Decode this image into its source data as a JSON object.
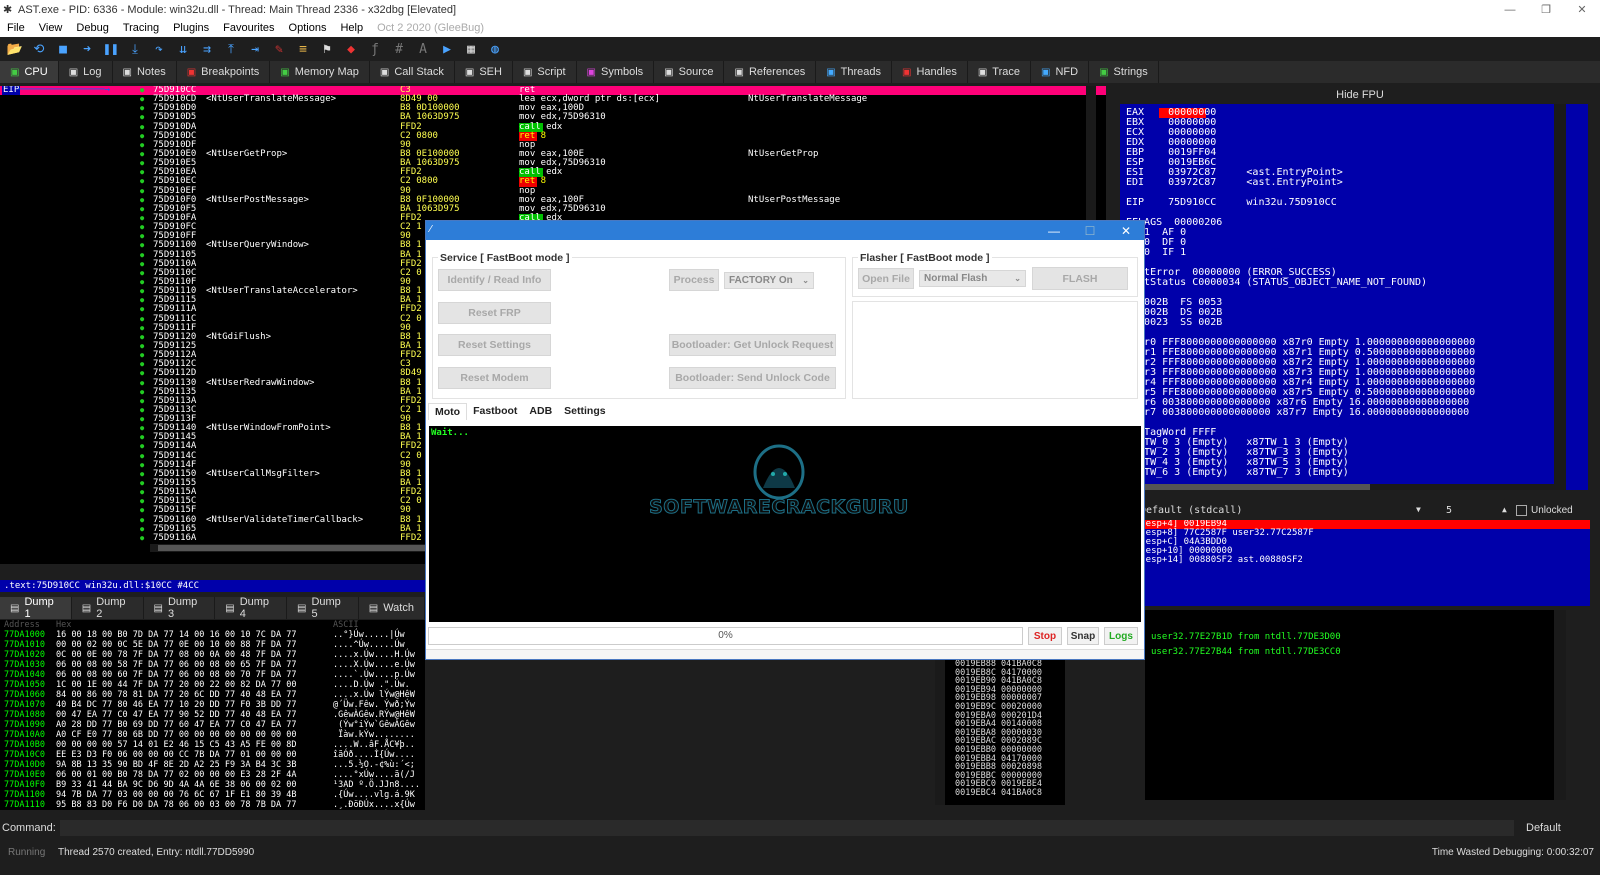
{
  "window": {
    "title": "AST.exe - PID: 6336 - Module: win32u.dll - Thread: Main Thread 2336 - x32dbg [Elevated]",
    "minimize": "—",
    "restore": "❐",
    "close": "✕"
  },
  "menu": [
    "File",
    "View",
    "Debug",
    "Tracing",
    "Plugins",
    "Favourites",
    "Options",
    "Help"
  ],
  "menu_date": "Oct 2 2020 (GleeBug)",
  "toolbar": [
    "open-icon",
    "restart-icon",
    "stop-icon",
    "run-icon",
    "pause-icon",
    "step-into-icon",
    "step-over-icon",
    "trace-into-icon",
    "trace-over-icon",
    "execute-till-return-icon",
    "run-to-user-code-icon",
    "patch-icon",
    "comment-icon",
    "label-icon",
    "bookmark-icon",
    "function-icon",
    "hash-icon",
    "font-icon",
    "script-icon",
    "calculator-icon",
    "globe-icon"
  ],
  "tabs": [
    {
      "label": "CPU",
      "icon": "cpu-icon",
      "color": "#4c4"
    },
    {
      "label": "Log",
      "icon": "log-icon",
      "color": "#ddd"
    },
    {
      "label": "Notes",
      "icon": "notes-icon",
      "color": "#ddd"
    },
    {
      "label": "Breakpoints",
      "icon": "breakpoint-icon",
      "color": "#e33"
    },
    {
      "label": "Memory Map",
      "icon": "memory-icon",
      "color": "#4c4"
    },
    {
      "label": "Call Stack",
      "icon": "callstack-icon",
      "color": "#ddd"
    },
    {
      "label": "SEH",
      "icon": "seh-icon",
      "color": "#ddd"
    },
    {
      "label": "Script",
      "icon": "script-icon",
      "color": "#ddd"
    },
    {
      "label": "Symbols",
      "icon": "symbols-icon",
      "color": "#d4d"
    },
    {
      "label": "Source",
      "icon": "source-icon",
      "color": "#ddd"
    },
    {
      "label": "References",
      "icon": "references-icon",
      "color": "#ddd"
    },
    {
      "label": "Threads",
      "icon": "threads-icon",
      "color": "#4af"
    },
    {
      "label": "Handles",
      "icon": "handles-icon",
      "color": "#e33"
    },
    {
      "label": "Trace",
      "icon": "trace-icon",
      "color": "#ddd"
    },
    {
      "label": "NFD",
      "icon": "nfd-icon",
      "color": "#4af"
    },
    {
      "label": "Strings",
      "icon": "strings-icon",
      "color": "#4c4"
    }
  ],
  "disasm": [
    [
      "EIP",
      "75D910CC",
      "",
      "C3",
      "ret",
      ""
    ],
    [
      "",
      "75D910CD",
      "<NtUserTranslateMessage>",
      "8D49 00",
      "lea ecx,dword ptr ds:[ecx]",
      "NtUserTranslateMessage"
    ],
    [
      "",
      "75D910D0",
      "",
      "B8 0D100000",
      "mov eax,100D",
      ""
    ],
    [
      "",
      "75D910D5",
      "",
      "BA 1063D975",
      "mov edx,75D96310",
      ""
    ],
    [
      "",
      "75D910DA",
      "",
      "FFD2",
      "call edx",
      ""
    ],
    [
      "",
      "75D910DC",
      "",
      "C2 0800",
      "ret 8",
      ""
    ],
    [
      "",
      "75D910DF",
      "",
      "90",
      "nop",
      ""
    ],
    [
      "",
      "75D910E0",
      "<NtUserGetProp>",
      "B8 0E100000",
      "mov eax,100E",
      "NtUserGetProp"
    ],
    [
      "",
      "75D910E5",
      "",
      "BA 1063D975",
      "mov edx,75D96310",
      ""
    ],
    [
      "",
      "75D910EA",
      "",
      "FFD2",
      "call edx",
      ""
    ],
    [
      "",
      "75D910EC",
      "",
      "C2 0800",
      "ret 8",
      ""
    ],
    [
      "",
      "75D910EF",
      "",
      "90",
      "nop",
      ""
    ],
    [
      "",
      "75D910F0",
      "<NtUserPostMessage>",
      "B8 0F100000",
      "mov eax,100F",
      "NtUserPostMessage"
    ],
    [
      "",
      "75D910F5",
      "",
      "BA 1063D975",
      "mov edx,75D96310",
      ""
    ],
    [
      "",
      "75D910FA",
      "",
      "FFD2",
      "call edx",
      ""
    ],
    [
      "",
      "75D910FC",
      "",
      "C2 1",
      "",
      ""
    ],
    [
      "",
      "75D910FF",
      "",
      "90",
      "",
      ""
    ],
    [
      "",
      "75D91100",
      "<NtUserQueryWindow>",
      "B8 1",
      "",
      ""
    ],
    [
      "",
      "75D91105",
      "",
      "BA 1",
      "",
      ""
    ],
    [
      "",
      "75D9110A",
      "",
      "FFD2",
      "",
      ""
    ],
    [
      "",
      "75D9110C",
      "",
      "C2 0",
      "",
      ""
    ],
    [
      "",
      "75D9110F",
      "",
      "90",
      "",
      ""
    ],
    [
      "",
      "75D91110",
      "<NtUserTranslateAccelerator>",
      "B8 1",
      "",
      ""
    ],
    [
      "",
      "75D91115",
      "",
      "BA 1",
      "",
      ""
    ],
    [
      "",
      "75D9111A",
      "",
      "FFD2",
      "",
      ""
    ],
    [
      "",
      "75D9111C",
      "",
      "C2 0",
      "",
      ""
    ],
    [
      "",
      "75D9111F",
      "",
      "90",
      "",
      ""
    ],
    [
      "",
      "75D91120",
      "<NtGdiFlush>",
      "B8 1",
      "",
      ""
    ],
    [
      "",
      "75D91125",
      "",
      "BA 1",
      "",
      ""
    ],
    [
      "",
      "75D9112A",
      "",
      "FFD2",
      "",
      ""
    ],
    [
      "",
      "75D9112C",
      "",
      "C3",
      "",
      ""
    ],
    [
      "",
      "75D9112D",
      "",
      "8D49",
      "",
      ""
    ],
    [
      "",
      "75D91130",
      "<NtUserRedrawWindow>",
      "B8 1",
      "",
      ""
    ],
    [
      "",
      "75D91135",
      "",
      "BA 1",
      "",
      ""
    ],
    [
      "",
      "75D9113A",
      "",
      "FFD2",
      "",
      ""
    ],
    [
      "",
      "75D9113C",
      "",
      "C2 1",
      "",
      ""
    ],
    [
      "",
      "75D9113F",
      "",
      "90",
      "",
      ""
    ],
    [
      "",
      "75D91140",
      "<NtUserWindowFromPoint>",
      "B8 1",
      "",
      ""
    ],
    [
      "",
      "75D91145",
      "",
      "BA 1",
      "",
      ""
    ],
    [
      "",
      "75D9114A",
      "",
      "FFD2",
      "",
      ""
    ],
    [
      "",
      "75D9114C",
      "",
      "C2 0",
      "",
      ""
    ],
    [
      "",
      "75D9114F",
      "",
      "90",
      "",
      ""
    ],
    [
      "",
      "75D91150",
      "<NtUserCallMsgFilter>",
      "B8 1",
      "",
      ""
    ],
    [
      "",
      "75D91155",
      "",
      "BA 1",
      "",
      ""
    ],
    [
      "",
      "75D9115A",
      "",
      "FFD2",
      "",
      ""
    ],
    [
      "",
      "75D9115C",
      "",
      "C2 0",
      "",
      ""
    ],
    [
      "",
      "75D9115F",
      "",
      "90",
      "",
      ""
    ],
    [
      "",
      "75D91160",
      "<NtUserValidateTimerCallback>",
      "B8 1",
      "",
      ""
    ],
    [
      "",
      "75D91165",
      "",
      "BA 1",
      "",
      ""
    ],
    [
      "",
      "75D9116A",
      "",
      "FFD2",
      "",
      ""
    ]
  ],
  "info_line": ".text:75D910CC win32u.dll:$10CC #4CC",
  "regs": {
    "header": "Hide FPU",
    "lines": [
      "EAX    00000000",
      "EBX    00000000",
      "ECX    00000000",
      "EDX    00000000",
      "EBP    0019FF04",
      "ESP    0019EB6C",
      "ESI    03972C87     <ast.EntryPoint>",
      "EDI    03972C87     <ast.EntryPoint>",
      "",
      "EIP    75D910CC     win32u.75D910CC",
      "",
      "EFLAGS  00000206",
      "ZF 1  AF 0",
      "OF 0  DF 0",
      "CF 0  IF 1",
      "",
      "LastError  00000000 (ERROR_SUCCESS)",
      "LastStatus C0000034 (STATUS_OBJECT_NAME_NOT_FOUND)",
      "",
      "GS 002B  FS 0053",
      "ES 002B  DS 002B",
      "CS 0023  SS 002B",
      "",
      "x87r0 FFF8000000000000000 x87r0 Empty 1.000000000000000000",
      "x87r1 FFE8000000000000000 x87r1 Empty 0.500000000000000000",
      "x87r2 FFF8000000000000000 x87r2 Empty 1.000000000000000000",
      "x87r3 FFF8000000000000000 x87r3 Empty 1.000000000000000000",
      "x87r4 FFF8000000000000000 x87r4 Empty 1.000000000000000000",
      "x87r5 FFE8000000000000000 x87r5 Empty 0.500000000000000000",
      "x87r6 003800000000000000 x87r6 Empty 16.00000000000000000",
      "x87r7 003800000000000000 x87r7 Empty 16.00000000000000000",
      "",
      "x87TagWord FFFF",
      "x87TW_0 3 (Empty)   x87TW_1 3 (Empty)",
      "x87TW_2 3 (Empty)   x87TW_3 3 (Empty)",
      "x87TW_4 3 (Empty)   x87TW_5 3 (Empty)",
      "x87TW_6 3 (Empty)   x87TW_7 3 (Empty)"
    ]
  },
  "stack_panel": {
    "conv": "Default (stdcall)",
    "count": "5",
    "unlocked": "Unlocked",
    "lines": [
      "1: [esp+4] 0019EB94",
      "2: [esp+8] 77C2587F user32.77C2587F",
      "3: [esp+C] 04A3BDD0",
      "4: [esp+10] 00000000",
      "5: [esp+14] 00880SF2 ast.00880SF2"
    ]
  },
  "dump_tabs": [
    "Dump 1",
    "Dump 2",
    "Dump 3",
    "Dump 4",
    "Dump 5",
    "Watch"
  ],
  "dump_header": {
    "addr": "Address",
    "hex": "Hex",
    "ascii": "ASCII"
  },
  "dump": [
    [
      "77DA1000",
      "16 00 18 00 B0 7D DA 77 14 00 16 00 10 7C DA 77",
      "..°}Úw.....|Úw"
    ],
    [
      "77DA1010",
      "00 00 02 00 0C 5E DA 77 0E 00 10 00 88 7F DA 77",
      "....^Úw.....Úw"
    ],
    [
      "77DA1020",
      "0C 00 0E 00 78 7F DA 77 08 00 0A 00 48 7F DA 77",
      "....x.Úw....H.Úw"
    ],
    [
      "77DA1030",
      "06 00 08 00 58 7F DA 77 06 00 08 00 65 7F DA 77",
      "....X.Úw....e.Úw"
    ],
    [
      "77DA1040",
      "06 00 08 00 60 7F DA 77 06 00 08 00 70 7F DA 77",
      "....`.Úw....p.Úw"
    ],
    [
      "77DA1050",
      "1C 00 1E 00 44 7F DA 77 20 00 22 00 82 DA 77 00",
      "....D.Úw .\".Úw."
    ],
    [
      "77DA1060",
      "84 00 86 00 78 81 DA 77 20 6C DD 77 40 48 EA 77",
      "....x.Úw lÝw@HêW"
    ],
    [
      "77DA1070",
      "40 B4 DC 77 80 46 EA 77 10 20 DD 77 F0 3B DD 77",
      "@´Üw.Fêw. Ýwð;Ýw"
    ],
    [
      "77DA1080",
      "00 47 EA 77 C0 47 EA 77 90 52 DD 77 40 48 EA 77",
      ".GêwÀGêw.RÝw@HêW"
    ],
    [
      "77DA1090",
      "A0 28 DD 77 B0 69 DD 77 60 47 EA 77 C0 47 EA 77",
      " (Ýw°iÝw`GêwÀGêw"
    ],
    [
      "77DA10A0",
      "A0 CF E0 77 80 6B DD 77 00 00 00 00 00 00 00 00",
      " Ïàw.kÝw........"
    ],
    [
      "77DA10B0",
      "00 00 00 00 57 14 01 E2 46 15 C5 43 A5 FE 00 8D",
      "....W..âF.ÅC¥þ.."
    ],
    [
      "77DA10C0",
      "EE E3 D3 F0 06 00 00 00 CC 7B DA 77 01 00 00 00",
      "îãÓð....Ì{Úw...."
    ],
    [
      "77DA10D0",
      "9A 8B 13 35 90 BD 4F 8E 2D A2 25 F9 3A B4 3C 3B",
      "...5.½O.-¢%ù:´<;"
    ],
    [
      "77DA10E0",
      "06 00 01 00 B0 78 DA 77 02 00 00 00 E3 28 2F 4A",
      "....°xÚw....ã(/J"
    ],
    [
      "77DA10F0",
      "B9 33 41 44 BA 9C D6 9D 4A 4A 6E 38 06 00 02 00",
      "¹3AD º.Ö.JJn8...."
    ],
    [
      "77DA1100",
      "94 7B DA 77 03 00 00 00 76 6C 67 1F E1 80 39 4B",
      ".{Úw....vlg.á.9K"
    ],
    [
      "77DA1110",
      "95 B8 83 D0 F6 D0 DA 78 06 00 03 00 78 7B DA 77",
      ".¸.ÐöÐÚx....x{Úw"
    ],
    [
      "77DA1120",
      "04 00 00 00 12 7A 0F 8E B3 BF E8 4F B9 A5 48 FD",
      ".....z..³¿èO¹¥Hý"
    ],
    [
      "77DA1130",
      "50 A1 5A 9A 0A 00 00 00 C4 7B DA 77 70 C6 E0 77",
      "P¡Z.....Ä{ÚwpÆàw"
    ]
  ],
  "stack": [
    "0019EB88 041BA0C8",
    "0019EB8C 04170000",
    "0019EB90 041BA0C8",
    "0019EB94 00000000",
    "0019EB98 00000007",
    "0019EB9C 00020000",
    "0019EBA0 000201D4",
    "0019EBA4 00140008",
    "0019EBA8 00000030",
    "0019EBAC 0002089C",
    "0019EBB0 00000000",
    "0019EBB4 04170000",
    "0019EBB8 00020898",
    "0019EBBC 00000000",
    "0019EBC0 0019EBE4",
    "0019EBC4 041BA0C8"
  ],
  "callstack": [
    "user32.77E27B1D from ntdll.77DE3D00",
    "user32.77E27B44 from ntdll.77DE3CC0"
  ],
  "cmd": {
    "label": "Command:",
    "mode": "Default"
  },
  "status": {
    "state": "Running",
    "msg": "Thread 2570 created, Entry: ntdll.77DD5990",
    "time": "Time Wasted Debugging: 0:00:32:07"
  },
  "dialog": {
    "service_title": "Service [ FastBoot mode ]",
    "flasher_title": "Flasher [ FastBoot mode ]",
    "identify": "Identify / Read Info",
    "process": "Process",
    "factory": "FACTORY On",
    "reset_frp": "Reset FRP",
    "reset_settings": "Reset Settings",
    "reset_modem": "Reset Modem",
    "bl_unlock": "Bootloader: Get Unlock Request",
    "bl_send": "Bootloader: Send Unlock Code",
    "open_file": "Open File",
    "flash_mode": "Normal Flash",
    "flash": "FLASH",
    "tabs": [
      "Moto",
      "Fastboot",
      "ADB",
      "Settings"
    ],
    "console_text": "Wait...",
    "watermark": "SOFTWARECRACKGURU",
    "progress": "0%",
    "progress_value": 0,
    "stop": "Stop",
    "snap": "Snap",
    "logs": "Logs",
    "colors": {
      "stop": "#d22",
      "logs": "#2a2"
    }
  }
}
